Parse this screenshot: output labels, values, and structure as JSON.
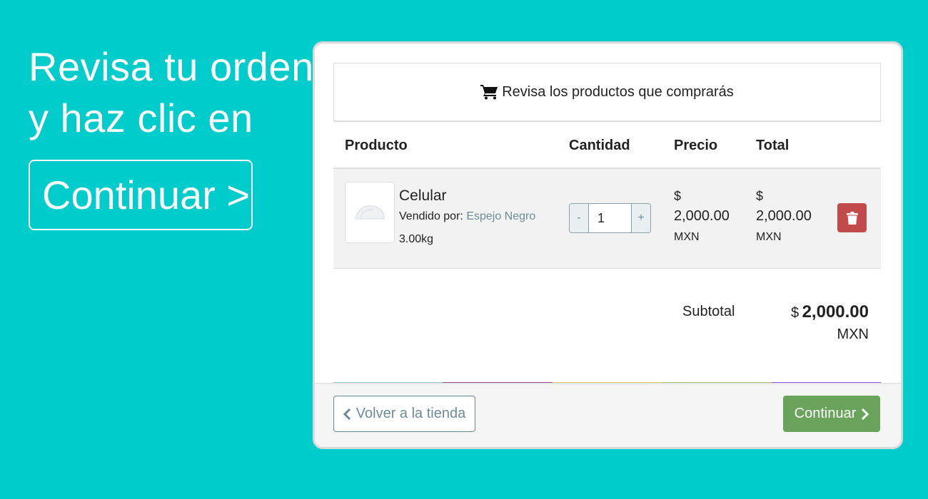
{
  "promo": {
    "line1": "Revisa tu orden",
    "line2": "y haz clic en",
    "cta": "Continuar >"
  },
  "cart": {
    "header_text": "Revisa los productos que comprarás",
    "header_icon": "cart-icon",
    "columns": {
      "product": "Producto",
      "quantity": "Cantidad",
      "price": "Precio",
      "total": "Total"
    },
    "item": {
      "name": "Celular",
      "seller_label": "Vendido por:",
      "seller_name": "Espejo Negro",
      "weight": "3.00kg",
      "qty_minus": "-",
      "qty_value": "1",
      "qty_plus": "+",
      "price_symbol": "$",
      "price_amount": "2,000.00",
      "price_currency": "MXN",
      "total_symbol": "$",
      "total_amount": "2,000.00",
      "total_currency": "MXN",
      "delete_icon": "trash-icon"
    },
    "subtotal": {
      "label": "Subtotal",
      "symbol": "$",
      "amount": "2,000.00",
      "currency": "MXN"
    },
    "color_bar": [
      "#8fc4c9",
      "#93477f",
      "#e2c65a",
      "#a9c06a",
      "#8b55e6"
    ],
    "footer": {
      "back_label": "Volver a la tienda",
      "next_label": "Continuar"
    }
  },
  "colors": {
    "background": "#00cccc",
    "danger": "#c24a4a",
    "success": "#6aa35b",
    "muted": "#6d8b95"
  }
}
